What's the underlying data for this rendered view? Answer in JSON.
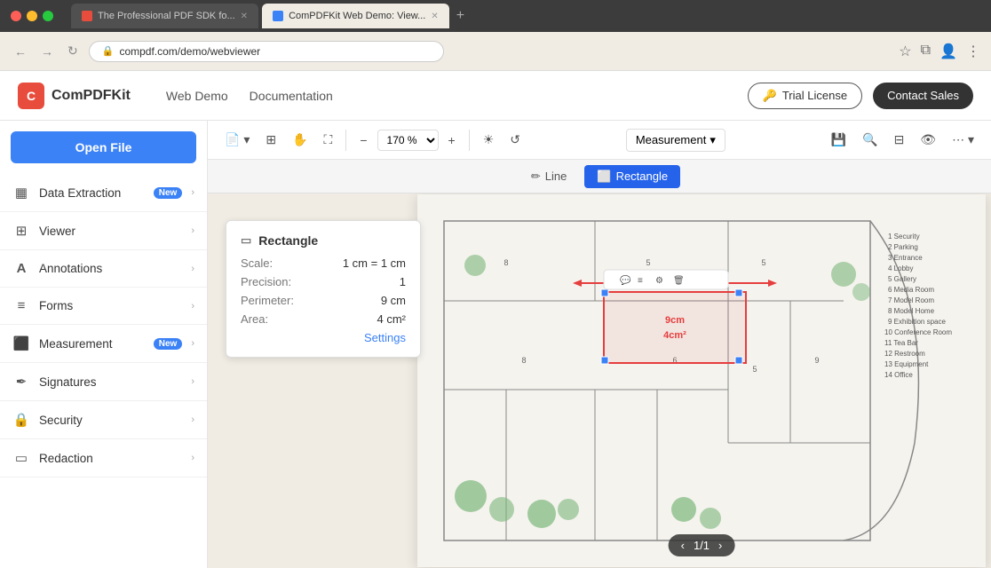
{
  "browser": {
    "tabs": [
      {
        "title": "The Professional PDF SDK fo...",
        "active": false,
        "favicon": "pdf"
      },
      {
        "title": "ComPDFKit Web Demo: View...",
        "active": true,
        "favicon": "compdf"
      }
    ],
    "address": "compdf.com/demo/webviewer"
  },
  "header": {
    "logo_letter": "C",
    "logo_name": "ComPDFKit",
    "nav_items": [
      "Web Demo",
      "Documentation"
    ],
    "btn_trial": "Trial License",
    "btn_contact": "Contact Sales"
  },
  "toolbar": {
    "zoom_value": "170 %",
    "measurement_label": "Measurement",
    "line_label": "Line",
    "rectangle_label": "Rectangle"
  },
  "sidebar": {
    "open_file": "Open File",
    "items": [
      {
        "id": "data-extraction",
        "label": "Data Extraction",
        "badge": "New",
        "icon": "▦",
        "has_chevron": true
      },
      {
        "id": "viewer",
        "label": "Viewer",
        "badge": null,
        "icon": "⊞",
        "has_chevron": true
      },
      {
        "id": "annotations",
        "label": "Annotations",
        "badge": null,
        "icon": "A",
        "has_chevron": true
      },
      {
        "id": "forms",
        "label": "Forms",
        "badge": null,
        "icon": "≡",
        "has_chevron": true
      },
      {
        "id": "measurement",
        "label": "Measurement",
        "badge": "New",
        "icon": "⬛",
        "has_chevron": true
      },
      {
        "id": "signatures",
        "label": "Signatures",
        "badge": null,
        "icon": "✒",
        "has_chevron": true
      },
      {
        "id": "security",
        "label": "Security",
        "badge": null,
        "icon": "🔒",
        "has_chevron": true
      },
      {
        "id": "redaction",
        "label": "Redaction",
        "badge": null,
        "icon": "▭",
        "has_chevron": true
      }
    ]
  },
  "measure_popup": {
    "title": "Rectangle",
    "rows": [
      {
        "label": "Scale:",
        "value": "1 cm = 1 cm"
      },
      {
        "label": "Precision:",
        "value": "1"
      },
      {
        "label": "Perimeter:",
        "value": "9 cm"
      },
      {
        "label": "Area:",
        "value": "4 cm²"
      }
    ],
    "settings_label": "Settings"
  },
  "pagination": {
    "current": "1",
    "total": "1",
    "display": "1/1"
  },
  "colors": {
    "accent": "#3b82f6",
    "brand": "#e74c3c",
    "active_btn": "#2563eb"
  }
}
